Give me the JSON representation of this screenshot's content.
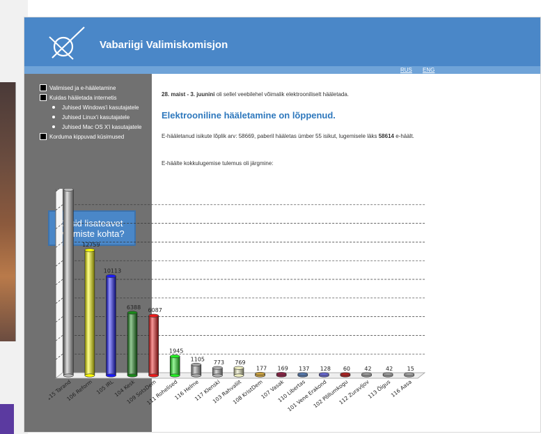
{
  "header": {
    "title": "Vabariigi Valimiskomisjon"
  },
  "lang": {
    "rus": "RUS",
    "eng": "ENG"
  },
  "sidebar": {
    "items": [
      {
        "label": "Valimised ja e-hääletamine",
        "level": 0
      },
      {
        "label": "Kuidas hääletada internetis",
        "level": 0
      },
      {
        "label": "Juhised Windows'i kasutajatele",
        "level": 1
      },
      {
        "label": "Juhised Linux'i kasutajatele",
        "level": 1
      },
      {
        "label": "Juhised Mac OS X'i kasutajatele",
        "level": 1
      },
      {
        "label": "Korduma kippuvad küsimused",
        "level": 0
      }
    ],
    "cta_line1": "Otsid lisateavet",
    "cta_line2": "valimiste kohta?"
  },
  "content": {
    "intro_bold": "28. maist - 3. juunini",
    "intro_rest": " oli sellel veebilehel võimalik elektrooniliselt hääletada.",
    "heading": "Elektrooniline hääletamine on lõppenud.",
    "para_text": "E-hääletanud isikute lõplik arv: 58669, paberil hääletas ümber 55 isikut, lugemisele läks ",
    "para_bold": "58614",
    "para_end": " e-häält.",
    "results_intro": "E-häälte kokkulugemise tulemus oli järgmine:"
  },
  "colors": {
    "header": "#4a87c8",
    "sidebar": "#717171",
    "heading": "#2e78bd"
  },
  "chart_data": {
    "type": "bar",
    "categories": [
      "115 Tarand",
      "106 Reform",
      "105 IRL",
      "104 Kesk",
      "109 SotsDem",
      "111 Rohelised",
      "116 Helme",
      "117 Klenski",
      "103 Rahvaliit",
      "108 KristDem",
      "107 Vasak",
      "110 Libertas",
      "101 Vene Erakond",
      "102 Põllumkogu",
      "112 Zuravljov",
      "113 Õigus",
      "116 Aasa"
    ],
    "values": [
      18905,
      12759,
      10113,
      6388,
      6087,
      1945,
      1105,
      773,
      769,
      177,
      169,
      137,
      128,
      60,
      42,
      42,
      15
    ],
    "colors": [
      "#b8b8b8",
      "#ffff00",
      "#1a1aff",
      "#1a8a1a",
      "#ee1c1c",
      "#22ee22",
      "#a6a6a6",
      "#b0b0b0",
      "#eeeec0",
      "#c9a040",
      "#882244",
      "#5577aa",
      "#6666cc",
      "#aa2222",
      "#999999",
      "#999999",
      "#a0a0a0"
    ],
    "ylim": [
      0,
      19000
    ],
    "grid": true
  }
}
